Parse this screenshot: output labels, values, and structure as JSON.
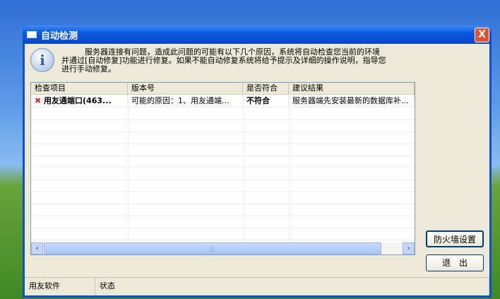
{
  "window": {
    "title": "自动检测",
    "close": "X"
  },
  "message": {
    "icon": "i",
    "text": "　　　服务器连接有问题，造成此问题的可能有以下几个原因，系统将自动检查您当前的环境并通过[自动修复]功能进行修复。如果不能自动修复系统将给予提示及详细的操作说明，指导您进行手动修复。"
  },
  "table": {
    "columns": [
      "检查项目",
      "版本号",
      "是否符合",
      "建议结果"
    ],
    "rows": [
      {
        "item": "用友通端口(463...",
        "version": "可能的原因：1、用友通端...",
        "match": "不符合",
        "advice": "服务器端先安装最新的数据库补..."
      }
    ]
  },
  "buttons": {
    "firewall": "防火墙设置",
    "exit": "退　出"
  },
  "statusbar": {
    "left": "用友软件",
    "right": "状态"
  }
}
